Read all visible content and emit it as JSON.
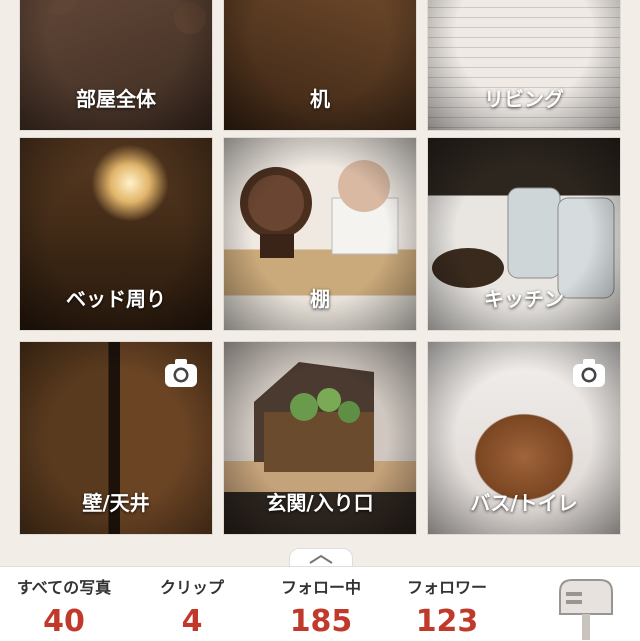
{
  "grid": {
    "tiles": [
      {
        "label": "部屋全体"
      },
      {
        "label": "机"
      },
      {
        "label": "リビング"
      },
      {
        "label": "ベッド周り"
      },
      {
        "label": "棚"
      },
      {
        "label": "キッチン"
      },
      {
        "label": "壁/天井"
      },
      {
        "label": "玄関/入り口"
      },
      {
        "label": "バス/トイレ"
      }
    ]
  },
  "stats": [
    {
      "label": "すべての写真",
      "value": "40"
    },
    {
      "label": "クリップ",
      "value": "4"
    },
    {
      "label": "フォロー中",
      "value": "185"
    },
    {
      "label": "フォロワー",
      "value": "123"
    }
  ],
  "colors": {
    "accent": "#c0392b",
    "background": "#f3ede7"
  },
  "icons": [
    "camera-icon",
    "chevron-up-icon",
    "mailbox-icon"
  ]
}
